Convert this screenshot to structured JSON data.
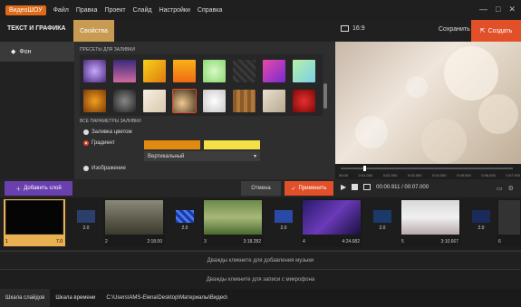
{
  "app": {
    "logo": "ВидеоШОУ",
    "menu": [
      "Файл",
      "Правка",
      "Проект",
      "Слайд",
      "Настройки",
      "Справка"
    ],
    "window_controls": [
      "—",
      "□",
      "✕"
    ]
  },
  "toolbar": {
    "tab_text": "ТЕКСТ И ГРАФИКА",
    "tab_props": "Свойства",
    "ratio": "16:9",
    "save": "Сохранить",
    "create": "Создать"
  },
  "left": {
    "item_bg": "Фон"
  },
  "fill": {
    "presets_title": "ПРЕСЕТЫ ДЛЯ ЗАЛИВКИ",
    "params_title": "ВСЕ ПАРАМЕТРЫ ЗАЛИВКИ",
    "opt_color": "Заливка цветом",
    "opt_gradient": "Градиент",
    "opt_image": "Изображение",
    "gradient_color1": "#e08a10",
    "gradient_color2": "#f2e044",
    "gradient_type": "Вертикальный"
  },
  "ruler": [
    "00:00",
    "0:01.000",
    "0:02.000",
    "0:03.000",
    "0:04.000",
    "0:05.000",
    "0:06.000",
    "0:07.000"
  ],
  "actions": {
    "add_layer": "Добавить слой",
    "cancel": "Отмена",
    "apply": "Применить",
    "time": "00:00.911 / 00:07.000"
  },
  "slides": [
    {
      "n": "1",
      "d": "7.0"
    },
    {
      "n": "2",
      "d": "2:18.00"
    },
    {
      "n": "3",
      "d": "3:18.282"
    },
    {
      "n": "4",
      "d": "4:24.682"
    },
    {
      "n": "5",
      "d": "3:10.667"
    },
    {
      "n": "6",
      "d": ""
    }
  ],
  "transitions": [
    "2.0",
    "2.0",
    "2.0",
    "2.0",
    "2.0"
  ],
  "strips": {
    "music": "Дважды кликните для добавления музыки",
    "mic": "Дважды кликните для записи с микрофона"
  },
  "status": {
    "tab1": "Шкала слайдов",
    "tab2": "Шкала времени",
    "path": "C:\\Users\\AMS-Elena\\Desktop\\Материалы\\Видео\\"
  }
}
